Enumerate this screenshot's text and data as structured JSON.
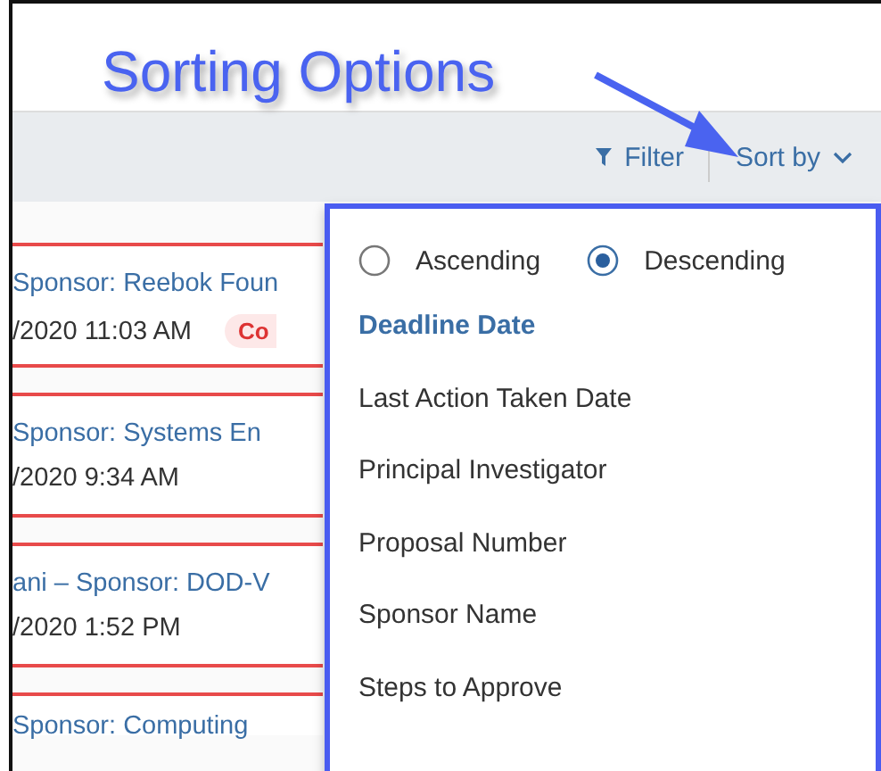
{
  "annotation": {
    "text": "Sorting Options"
  },
  "toolbar": {
    "filter": "Filter",
    "sort_by": "Sort by"
  },
  "rows": [
    {
      "title": "Sponsor: Reebok Foun",
      "date": "/2020 11:03 AM",
      "badge": "Co"
    },
    {
      "title": "Sponsor: Systems En",
      "date": "/2020 9:34 AM"
    },
    {
      "title": "ani – Sponsor: DOD-V",
      "date": "/2020 1:52 PM"
    },
    {
      "title": "Sponsor: Computing"
    }
  ],
  "sort_menu": {
    "order": [
      {
        "label": "Ascending",
        "selected": false
      },
      {
        "label": "Descending",
        "selected": true
      }
    ],
    "fields": [
      {
        "label": "Deadline Date",
        "selected": true
      },
      {
        "label": "Last Action Taken Date",
        "selected": false
      },
      {
        "label": "Principal Investigator",
        "selected": false
      },
      {
        "label": "Proposal Number",
        "selected": false
      },
      {
        "label": "Sponsor Name",
        "selected": false
      },
      {
        "label": "Steps to Approve",
        "selected": false
      }
    ]
  }
}
